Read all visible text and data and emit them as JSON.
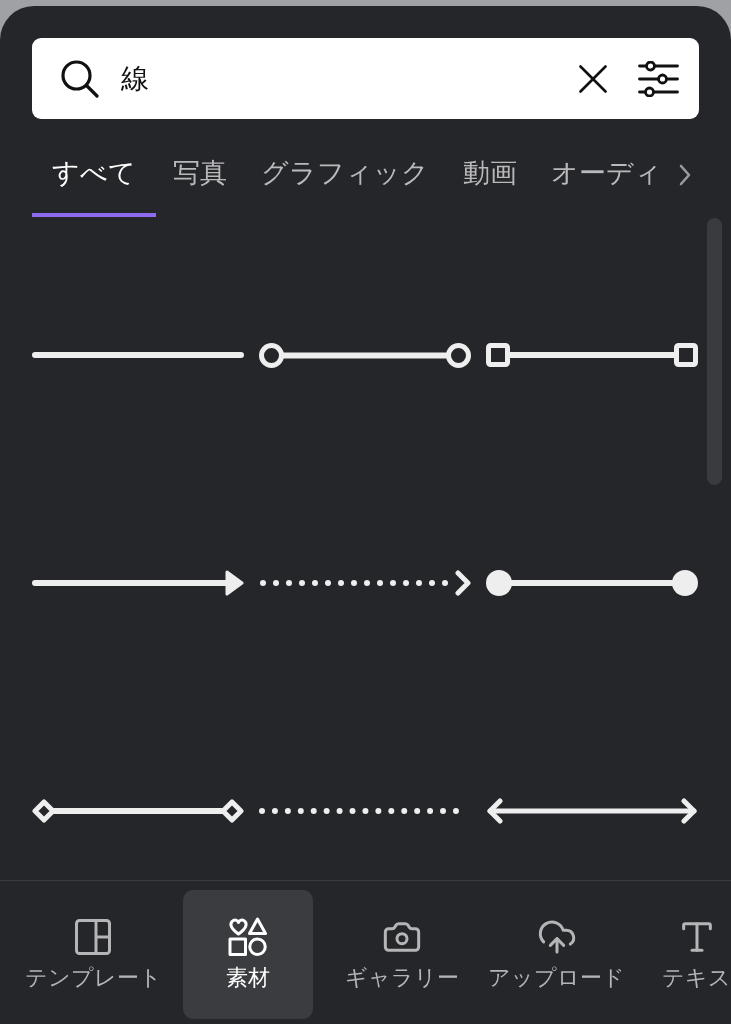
{
  "search": {
    "value": "線"
  },
  "tabs": [
    {
      "label": "すべて",
      "selected": true
    },
    {
      "label": "写真",
      "selected": false
    },
    {
      "label": "グラフィック",
      "selected": false
    },
    {
      "label": "動画",
      "selected": false
    },
    {
      "label": "オーディ",
      "selected": false
    }
  ],
  "results": [
    {
      "kind": "solid"
    },
    {
      "kind": "rings"
    },
    {
      "kind": "boxes"
    },
    {
      "kind": "arrow"
    },
    {
      "kind": "chevron"
    },
    {
      "kind": "discs"
    },
    {
      "kind": "diamonds"
    },
    {
      "kind": "dotted"
    },
    {
      "kind": "double"
    }
  ],
  "bottom_nav": [
    {
      "kind": "templates",
      "label": "テンプレート",
      "selected": false
    },
    {
      "kind": "elements",
      "label": "素材",
      "selected": true
    },
    {
      "kind": "gallery",
      "label": "ギャラリー",
      "selected": false
    },
    {
      "kind": "upload",
      "label": "アップロード",
      "selected": false
    },
    {
      "kind": "text",
      "label": "テキス",
      "selected": false
    }
  ]
}
